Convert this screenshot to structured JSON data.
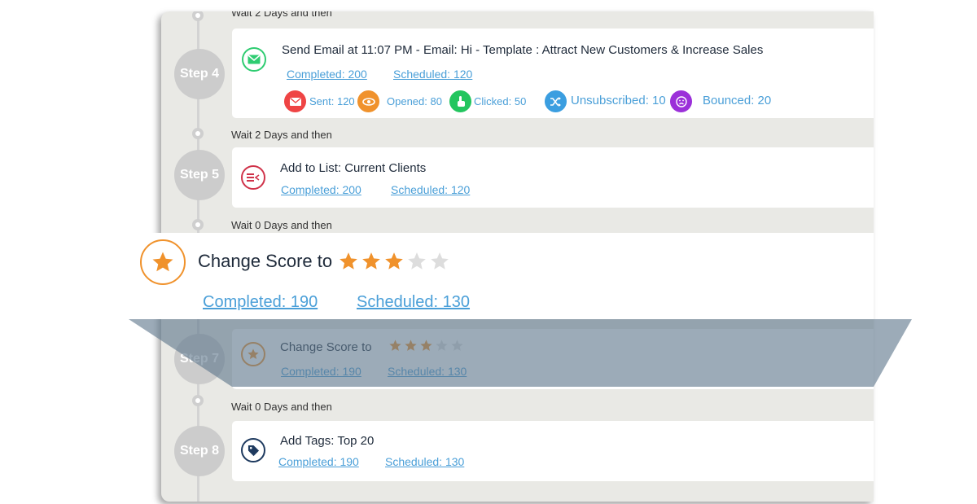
{
  "waits": [
    "Wait 2 Days and then",
    "Wait 2 Days and then",
    "Wait 0 Days and then",
    "Wait 0 Days and then"
  ],
  "steps": {
    "step4": {
      "label": "Step 4",
      "title": "Send Email at 11:07 PM - Email: Hi - Template : Attract New Customers & Increase Sales",
      "completed": "Completed: 200",
      "scheduled": "Scheduled: 120",
      "stats": {
        "sent": "Sent: 120",
        "opened": "Opened: 80",
        "clicked": "Clicked: 50",
        "unsubscribed": "Unsubscribed: 10",
        "bounced": "Bounced: 20"
      }
    },
    "step5": {
      "label": "Step 5",
      "title": "Add to List: Current Clients",
      "completed": "Completed: 200",
      "scheduled": "Scheduled: 120"
    },
    "step7": {
      "label": "Step 7",
      "title": "Change Score to",
      "score": 3,
      "max_score": 5,
      "completed": "Completed: 190",
      "scheduled": "Scheduled: 130"
    },
    "step8": {
      "label": "Step 8",
      "title": "Add Tags: Top 20",
      "completed": "Completed: 190",
      "scheduled": "Scheduled: 130"
    }
  },
  "zoom": {
    "title": "Change Score to",
    "score": 3,
    "max_score": 5,
    "completed": "Completed: 190",
    "scheduled": "Scheduled: 130"
  },
  "colors": {
    "link": "#4a9fd8",
    "star_on": "#f0922c",
    "star_off": "#dddddd",
    "email_green": "#2ecc71",
    "list_red": "#d0334a",
    "tag_navy": "#1e3a5f",
    "sent": "#ef4444",
    "opened": "#f0922c",
    "clicked": "#22c55e",
    "unsubscribed": "#3b9ee0",
    "bounced": "#9b30d9"
  }
}
